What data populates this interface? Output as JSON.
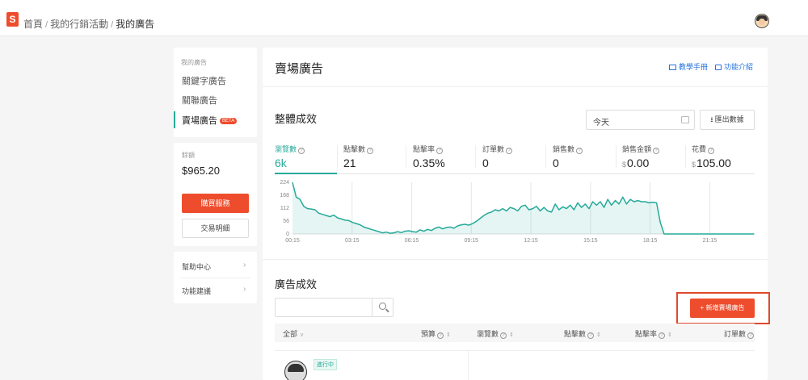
{
  "topbar": {
    "logo": "S",
    "breadcrumb": [
      "首頁",
      "我的行銷活動",
      "我的廣告"
    ],
    "separator": "/"
  },
  "sidebar": {
    "title": "我的廣告",
    "items": [
      {
        "label": "關鍵字廣告"
      },
      {
        "label": "關聯廣告"
      },
      {
        "label": "賣場廣告",
        "badge": "BETA",
        "active": true
      }
    ]
  },
  "balance": {
    "label": "餘額",
    "value": "$965.20",
    "buy_label": "購買服務",
    "history_label": "交易明細"
  },
  "help": {
    "items": [
      {
        "label": "幫助中心",
        "chevron": "›"
      },
      {
        "label": "功能建議",
        "chevron": "›"
      }
    ]
  },
  "main": {
    "title": "賣場廣告",
    "tutorial_label": "教學手冊",
    "intro_label": "功能介紹",
    "overall_title": "整體成效",
    "date_value": "今天",
    "export_label": "匯出數據",
    "ad_title": "廣告成效",
    "search_placeholder": "",
    "new_ad_label": "+ 新增賣場廣告"
  },
  "metrics": [
    {
      "label": "瀏覽數",
      "value": "6k",
      "currency": "",
      "active": true
    },
    {
      "label": "點擊數",
      "value": "21",
      "currency": ""
    },
    {
      "label": "點擊率",
      "value": "0.35%",
      "currency": ""
    },
    {
      "label": "訂單數",
      "value": "0",
      "currency": ""
    },
    {
      "label": "銷售數",
      "value": "0",
      "currency": ""
    },
    {
      "label": "銷售金額",
      "value": "0.00",
      "currency": "$"
    },
    {
      "label": "花費",
      "value": "105.00",
      "currency": "$"
    }
  ],
  "chart_data": {
    "type": "area",
    "x_ticks": [
      "00:15",
      "03:15",
      "06:15",
      "09:15",
      "12:15",
      "15:15",
      "18:15",
      "21:15"
    ],
    "y_ticks": [
      224,
      168,
      112,
      56,
      0
    ],
    "ylim": [
      0,
      224
    ],
    "grid": true,
    "color": "#26aa99",
    "series": [
      {
        "values": [
          224,
          160,
          150,
          120,
          110,
          108,
          105,
          90,
          85,
          80,
          75,
          82,
          70,
          65,
          60,
          58,
          50,
          45,
          40,
          30,
          25,
          20,
          15,
          10,
          5,
          8,
          3,
          5,
          10,
          6,
          12,
          14,
          10,
          8,
          18,
          12,
          20,
          15,
          25,
          30,
          22,
          28,
          30,
          25,
          35,
          40,
          42,
          38,
          45,
          55,
          68,
          80,
          90,
          95,
          105,
          100,
          110,
          100,
          115,
          110,
          100,
          120,
          125,
          105,
          110,
          120,
          100,
          115,
          100,
          95,
          130,
          105,
          118,
          110,
          125,
          105,
          135,
          115,
          130,
          110,
          140,
          125,
          140,
          115,
          150,
          125,
          145,
          130,
          160,
          130,
          150,
          140,
          145,
          140,
          140,
          135,
          138,
          135,
          50,
          0,
          0,
          0,
          0,
          0,
          0,
          0,
          0,
          0,
          0,
          0,
          0,
          0,
          0,
          0,
          0,
          0,
          0,
          0,
          0,
          0,
          0,
          0,
          0,
          0
        ]
      }
    ]
  },
  "table": {
    "columns": [
      {
        "label": "全部",
        "dropdown": "∨"
      },
      {
        "label": "預算",
        "help": "?",
        "sort": "⇕"
      },
      {
        "label": "瀏覽數",
        "help": "?",
        "sort": "⇕"
      },
      {
        "label": "點擊數",
        "help": "?",
        "sort": "⇕"
      },
      {
        "label": "點擊率",
        "help": "?",
        "sort": "⇕"
      },
      {
        "label": "訂單數",
        "help": "?"
      }
    ],
    "rows": [
      {
        "status": "進行中"
      }
    ]
  }
}
